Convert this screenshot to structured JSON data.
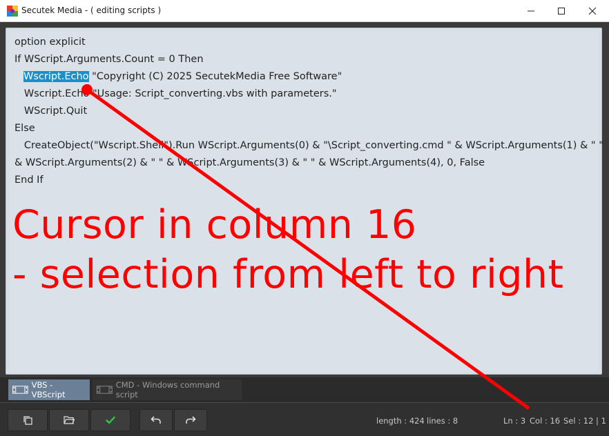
{
  "window": {
    "title": "Secutek Media - ( editing scripts )"
  },
  "editor": {
    "lines": [
      "option explicit",
      "If WScript.Arguments.Count = 0 Then",
      "Wscript.Echo",
      " \"Copyright (C) 2025 SecutekMedia Free Software\"",
      "   Wscript.Echo \"Usage: Script_converting.vbs with parameters.\"",
      "   WScript.Quit",
      "Else",
      "   CreateObject(\"Wscript.Shell\").Run WScript.Arguments(0) & \"\\Script_converting.cmd \" & WScript.Arguments(1) & \" \"",
      "& WScript.Arguments(2) & \" \" & WScript.Arguments(3) & \" \" & WScript.Arguments(4), 0, False",
      "End If"
    ],
    "selected_text": "Wscript.Echo",
    "highlight_color": "#1a8fc9"
  },
  "annotation": {
    "line1": "Cursor in column 16",
    "line2": "- selection from left to right",
    "color": "#ff0000"
  },
  "tabs": [
    {
      "label": "VBS - VBScript",
      "active": true
    },
    {
      "label": "CMD - Windows command script",
      "active": false
    }
  ],
  "toolbar": {
    "icons": [
      "copy-icon",
      "open-folder-icon",
      "check-icon",
      "undo-icon",
      "redo-icon"
    ],
    "accent": "#2ecc40"
  },
  "status": {
    "length": "length : 424",
    "lines": "lines : 8",
    "ln": "Ln : 3",
    "col": "Col : 16",
    "sel": "Sel : 12 | 1"
  }
}
